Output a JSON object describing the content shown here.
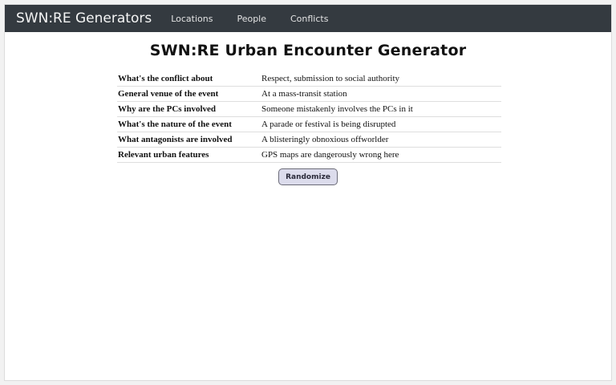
{
  "navbar": {
    "brand": "SWN:RE Generators",
    "links": [
      "Locations",
      "People",
      "Conflicts"
    ]
  },
  "page": {
    "title": "SWN:RE Urban Encounter Generator"
  },
  "table": {
    "rows": [
      {
        "label": "What's the conflict about",
        "value": "Respect, submission to social authority"
      },
      {
        "label": "General venue of the event",
        "value": "At a mass-transit station"
      },
      {
        "label": "Why are the PCs involved",
        "value": "Someone mistakenly involves the PCs in it"
      },
      {
        "label": "What's the nature of the event",
        "value": "A parade or festival is being disrupted"
      },
      {
        "label": "What antagonists are involved",
        "value": "A blisteringly obnoxious offworlder"
      },
      {
        "label": "Relevant urban features",
        "value": "GPS maps are dangerously wrong here"
      }
    ]
  },
  "button": {
    "label": "Randomize"
  }
}
